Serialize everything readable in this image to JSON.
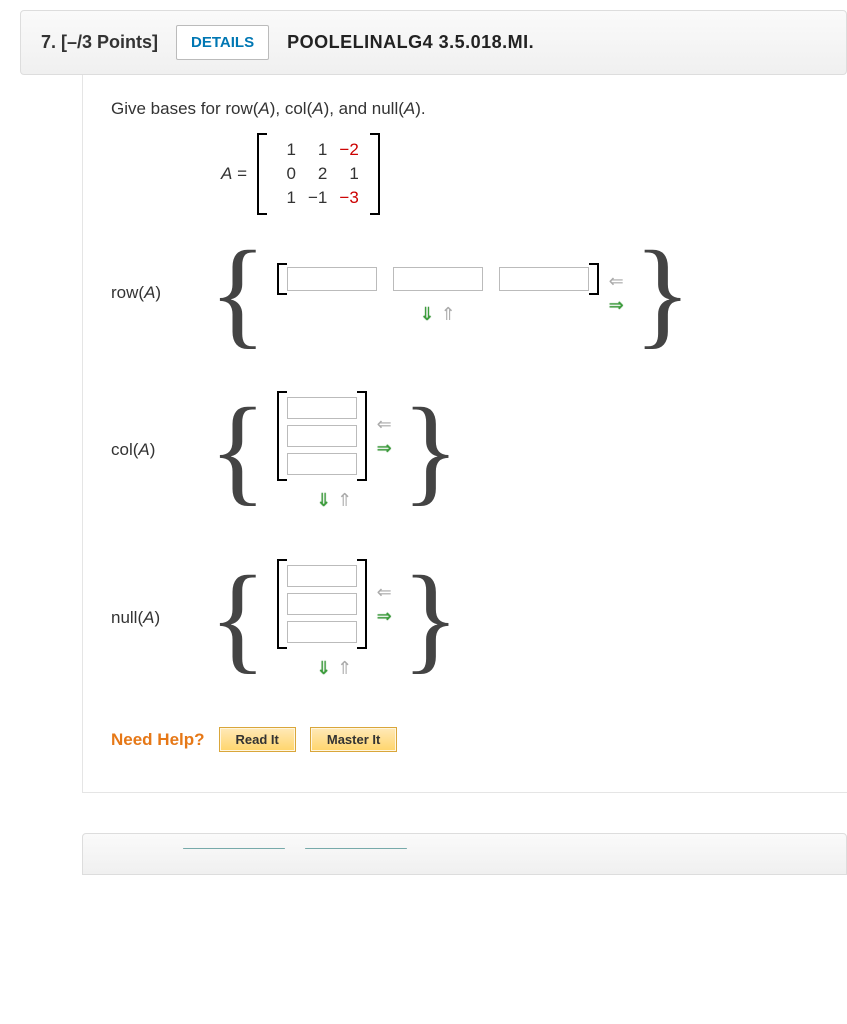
{
  "header": {
    "number": "7.",
    "points": "[–/3 Points]",
    "details_label": "DETAILS",
    "code": "POOLELINALG4 3.5.018.MI."
  },
  "instruction_prefix": "Give bases for row(",
  "instruction_mid1": "), col(",
  "instruction_mid2": "), and null(",
  "instruction_end": ").",
  "A_label": "A",
  "equals": " = ",
  "matrix": {
    "rows": [
      {
        "c0": "1",
        "c1": "1",
        "c2": "−2",
        "red2": true
      },
      {
        "c0": "0",
        "c1": "2",
        "c2": "1"
      },
      {
        "c0": "1",
        "c1": "−1",
        "c2": "−3",
        "red2": true
      }
    ]
  },
  "spaces": {
    "row_label_pre": "row(",
    "col_label_pre": "col(",
    "null_label_pre": "null(",
    "label_post": ")"
  },
  "help": {
    "label": "Need Help?",
    "read": "Read It",
    "master": "Master It"
  },
  "icons": {
    "left": "⇐",
    "right": "⇒",
    "down": "⇓",
    "up": "⇑"
  }
}
